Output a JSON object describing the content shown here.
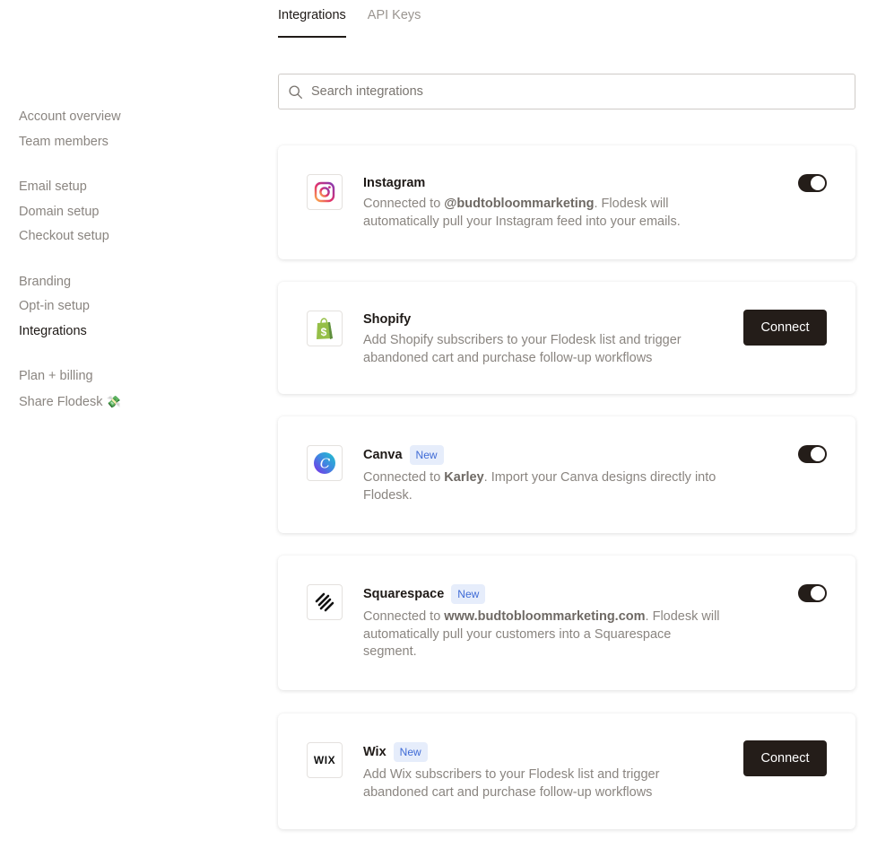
{
  "sidebar": {
    "groups": [
      {
        "items": [
          {
            "label": "Account overview"
          },
          {
            "label": "Team members"
          }
        ]
      },
      {
        "items": [
          {
            "label": "Email setup"
          },
          {
            "label": "Domain setup"
          },
          {
            "label": "Checkout setup"
          }
        ]
      },
      {
        "items": [
          {
            "label": "Branding"
          },
          {
            "label": "Opt-in setup"
          },
          {
            "label": "Integrations",
            "active": true
          }
        ]
      },
      {
        "items": [
          {
            "label": "Plan + billing"
          },
          {
            "label": "Share Flodesk",
            "emoji": "💸"
          }
        ]
      }
    ]
  },
  "tabs": [
    {
      "label": "Integrations",
      "active": true
    },
    {
      "label": "API Keys"
    }
  ],
  "search": {
    "placeholder": "Search integrations",
    "value": ""
  },
  "integrations": [
    {
      "name": "Instagram",
      "icon": "instagram-icon",
      "badge": "",
      "desc_prefix": "Connected to ",
      "desc_bold": "@budtobloommarketing",
      "desc_suffix": ". Flodesk will automatically pull your Instagram feed into your emails.",
      "connected": true
    },
    {
      "name": "Shopify",
      "icon": "shopify-icon",
      "badge": "",
      "description": "Add Shopify subscribers to your Flodesk list and trigger abandoned cart and purchase follow-up workflows",
      "action_label": "Connect",
      "connected": false
    },
    {
      "name": "Canva",
      "icon": "canva-icon",
      "badge": "New",
      "desc_prefix": "Connected to ",
      "desc_bold": "Karley",
      "desc_suffix": ". Import your Canva designs directly into Flodesk.",
      "connected": true
    },
    {
      "name": "Squarespace",
      "icon": "squarespace-icon",
      "badge": "New",
      "desc_prefix": "Connected to ",
      "desc_bold": "www.budtobloommarketing.com",
      "desc_suffix": ". Flodesk will automatically pull your customers into a Squarespace segment.",
      "connected": true
    },
    {
      "name": "Wix",
      "icon": "wix-icon",
      "logo_text": "WIX",
      "badge": "New",
      "description": "Add Wix subscribers to your Flodesk list and trigger abandoned cart and purchase follow-up workflows",
      "action_label": "Connect",
      "connected": false
    }
  ],
  "colors": {
    "primary_dark": "#241d19",
    "badge_text": "#3f6bd6",
    "badge_bg": "#e6edfb",
    "muted_text": "#8a8580"
  }
}
